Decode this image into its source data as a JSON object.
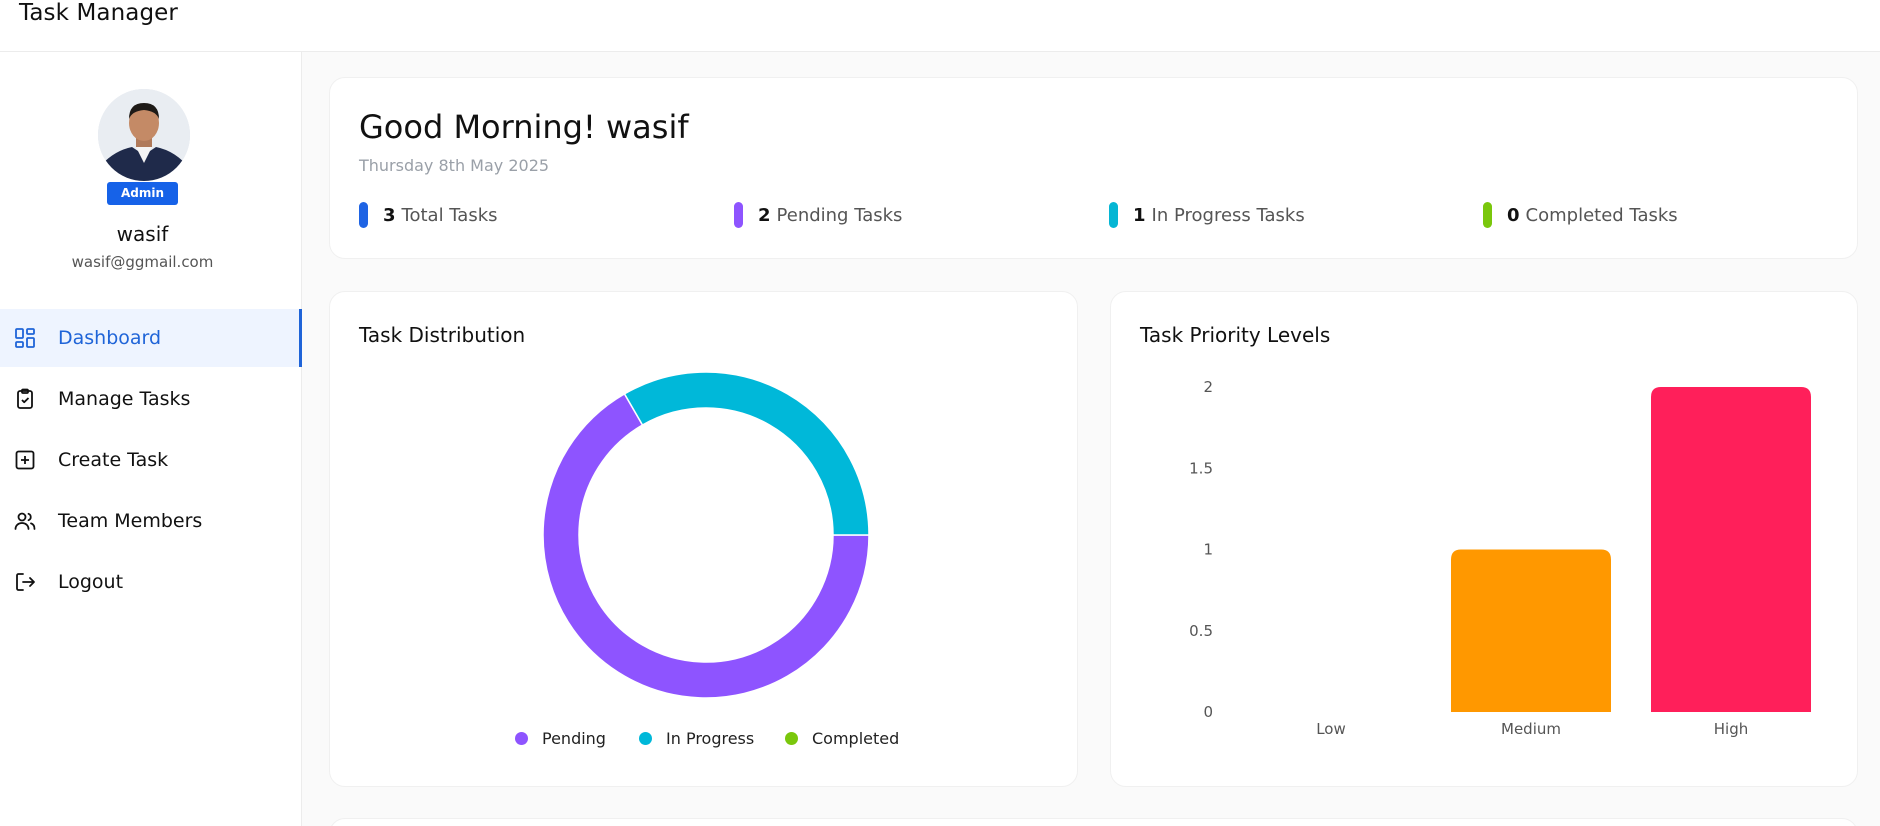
{
  "app": {
    "title": "Task Manager"
  },
  "profile": {
    "role": "Admin",
    "name": "wasif",
    "email": "wasif@ggmail.com"
  },
  "sidebar": {
    "items": [
      {
        "label": "Dashboard",
        "icon": "dashboard-icon",
        "active": true
      },
      {
        "label": "Manage Tasks",
        "icon": "clipboard-check-icon"
      },
      {
        "label": "Create Task",
        "icon": "plus-square-icon"
      },
      {
        "label": "Team Members",
        "icon": "users-icon"
      },
      {
        "label": "Logout",
        "icon": "logout-icon"
      }
    ]
  },
  "header": {
    "greeting": "Good Morning! wasif",
    "date": "Thursday 8th May 2025",
    "stats": [
      {
        "count": "3",
        "label": "Total Tasks",
        "color": "#1f64e4"
      },
      {
        "count": "2",
        "label": "Pending Tasks",
        "color": "#8e54ff"
      },
      {
        "count": "1",
        "label": "In Progress Tasks",
        "color": "#06b6d4"
      },
      {
        "count": "0",
        "label": "Completed Tasks",
        "color": "#7ac70c"
      }
    ]
  },
  "distribution": {
    "title": "Task Distribution"
  },
  "priority": {
    "title": "Task Priority Levels"
  },
  "chart_data": [
    {
      "type": "pie",
      "title": "Task Distribution",
      "categories": [
        "Pending",
        "In Progress",
        "Completed"
      ],
      "values": [
        2,
        1,
        0
      ],
      "colors": [
        "#8e54ff",
        "#00b8d9",
        "#7ac70c"
      ],
      "legend_position": "bottom"
    },
    {
      "type": "bar",
      "title": "Task Priority Levels",
      "categories": [
        "Low",
        "Medium",
        "High"
      ],
      "values": [
        0,
        1,
        2
      ],
      "colors": [
        "#00b8d9",
        "#ff9800",
        "#ff1f5a"
      ],
      "yticks": [
        "0",
        "0.5",
        "1",
        "1.5",
        "2"
      ],
      "ylim": [
        0,
        2
      ],
      "grid": false
    }
  ]
}
